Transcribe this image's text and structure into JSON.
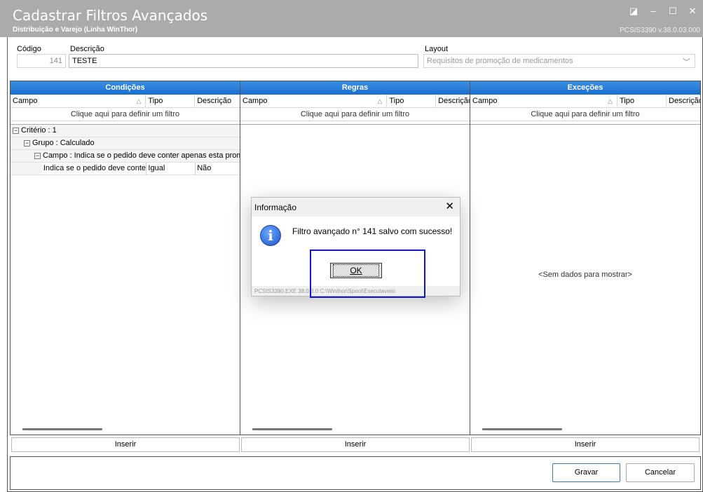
{
  "window": {
    "title": "Cadastrar Filtros Avançados",
    "subtitle": "Distribuição e Varejo (Linha WinThor)",
    "version": "PCSIS3390  v.38.0.03.000"
  },
  "form": {
    "codigo_label": "Código",
    "codigo_value": "141",
    "descricao_label": "Descrição",
    "descricao_value": "TESTE",
    "layout_label": "Layout",
    "layout_value": "Requisitos de promoção de medicamentos"
  },
  "panels": {
    "condicoes": {
      "header": "Condições",
      "col_campo": "Campo",
      "col_tipo": "Tipo",
      "col_descricao": "Descrição",
      "filter_hint": "Clique aqui para definir um filtro",
      "tree": {
        "criterio": "Critério : 1",
        "grupo": "Grupo : Calculado",
        "campo": "Campo : Indica se o pedido deve conter apenas esta promoção",
        "row_campo": "Indica se o pedido deve conter apenas esta promoção",
        "row_tipo": "Igual",
        "row_descricao": "Não"
      },
      "insert_label": "Inserir"
    },
    "regras": {
      "header": "Regras",
      "col_campo": "Campo",
      "col_tipo": "Tipo",
      "col_descricao": "Descrição",
      "filter_hint": "Clique aqui para definir um filtro",
      "insert_label": "Inserir"
    },
    "excecoes": {
      "header": "Exceções",
      "col_campo": "Campo",
      "col_tipo": "Tipo",
      "col_descricao": "Descrição",
      "filter_hint": "Clique aqui para definir um filtro",
      "no_data": "<Sem dados para mostrar>",
      "insert_label": "Inserir"
    }
  },
  "footer": {
    "gravar_label": "Gravar",
    "cancelar_label": "Cancelar"
  },
  "dialog": {
    "title": "Informação",
    "message": "Filtro avançado n° 141 salvo com sucesso!",
    "ok_label": "OK",
    "status": "PCSIS3390.EXE 38.0.3.0 C:\\Winthor\\Spool\\Executaveis\\"
  },
  "icons": {
    "info": "information-icon",
    "close": "close-icon"
  },
  "colors": {
    "header_blue": "#1a6fcf",
    "titlebar_gray": "#a9abad",
    "highlight": "#1515c8"
  }
}
